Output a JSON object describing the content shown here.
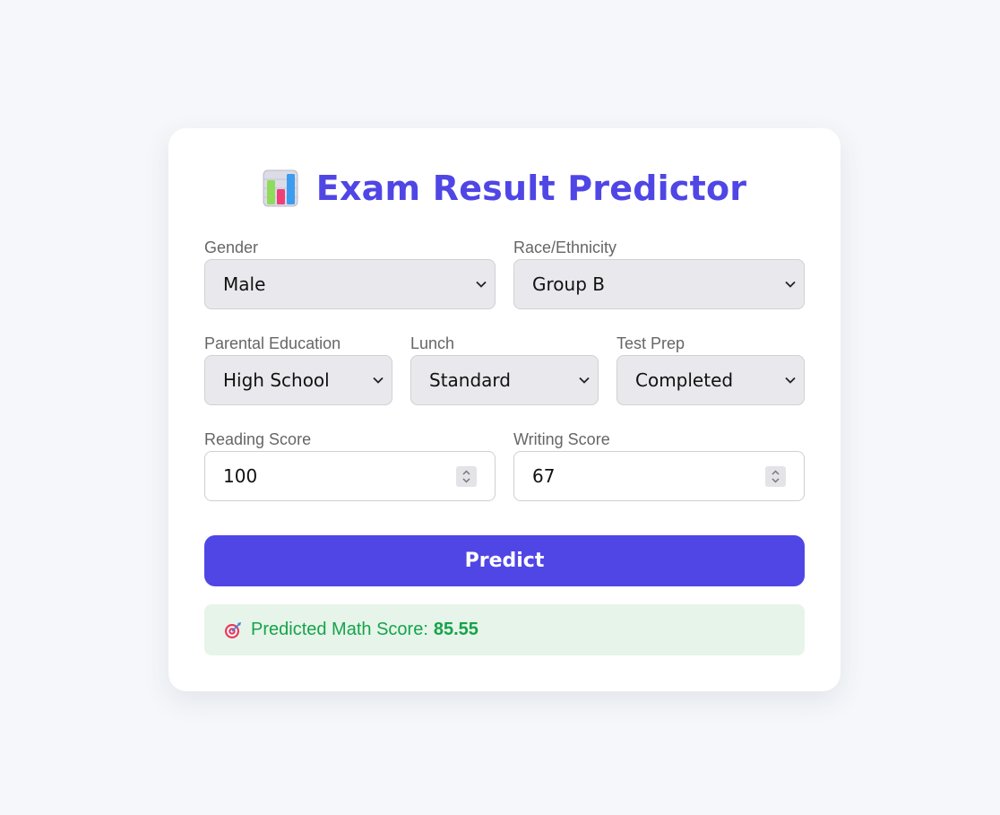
{
  "app": {
    "title": "Exam Result Predictor",
    "title_icon": "bar-chart-icon",
    "accent_color": "#4f46e5"
  },
  "form": {
    "gender": {
      "label": "Gender",
      "value": "Male"
    },
    "race": {
      "label": "Race/Ethnicity",
      "value": "Group B"
    },
    "parental_education": {
      "label": "Parental Education",
      "value": "High School"
    },
    "lunch": {
      "label": "Lunch",
      "value": "Standard"
    },
    "test_prep": {
      "label": "Test Prep",
      "value": "Completed"
    },
    "reading_score": {
      "label": "Reading Score",
      "value": "100"
    },
    "writing_score": {
      "label": "Writing Score",
      "value": "67"
    }
  },
  "predict_button": {
    "label": "Predict"
  },
  "result": {
    "icon": "target-icon",
    "label": "Predicted Math Score:",
    "value": "85.55",
    "color": "#16a34a"
  }
}
